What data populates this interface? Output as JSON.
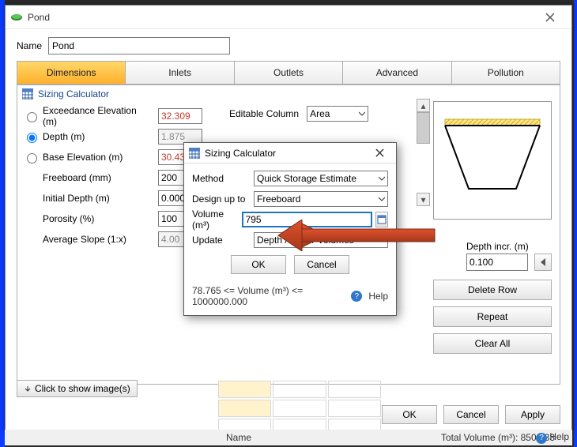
{
  "title": "Pond",
  "name_label": "Name",
  "name_value": "Pond",
  "tabs": [
    "Dimensions",
    "Inlets",
    "Outlets",
    "Advanced",
    "Pollution"
  ],
  "panel_title": "Sizing Calculator",
  "editable_column_label": "Editable Column",
  "editable_column_value": "Area",
  "fields": {
    "exceedance": {
      "label": "Exceedance Elevation (m)",
      "value": "32.309"
    },
    "depth": {
      "label": "Depth (m)",
      "value": "1.875"
    },
    "base": {
      "label": "Base Elevation (m)",
      "value": "30.434"
    },
    "freeboard": {
      "label": "Freeboard (mm)",
      "value": "200"
    },
    "initdepth": {
      "label": "Initial Depth (m)",
      "value": "0.000"
    },
    "porosity": {
      "label": "Porosity (%)",
      "value": "100"
    },
    "avgslope": {
      "label": "Average Slope (1:x)",
      "value": "4.00"
    }
  },
  "depth_incr_label": "Depth incr. (m)",
  "depth_incr_value": "0.100",
  "side_buttons": {
    "delete": "Delete Row",
    "repeat": "Repeat",
    "clear": "Clear All"
  },
  "click_images": "Click to show image(s)",
  "bottom": {
    "ok": "OK",
    "cancel": "Cancel",
    "apply": "Apply"
  },
  "status": {
    "name": "Name",
    "total_volume": "Total Volume (m³): 850.833",
    "help": "Help"
  },
  "dialog": {
    "title": "Sizing Calculator",
    "method_label": "Method",
    "method_value": "Quick Storage Estimate",
    "design_label": "Design up to",
    "design_value": "Freeboard",
    "volume_label": "Volume (m³)",
    "volume_value": "795",
    "update_label": "Update",
    "update_value": "Depth / Area / Volumes",
    "ok": "OK",
    "cancel": "Cancel",
    "footer": "78.765 <= Volume (m³) <= 1000000.000",
    "help": "Help"
  }
}
